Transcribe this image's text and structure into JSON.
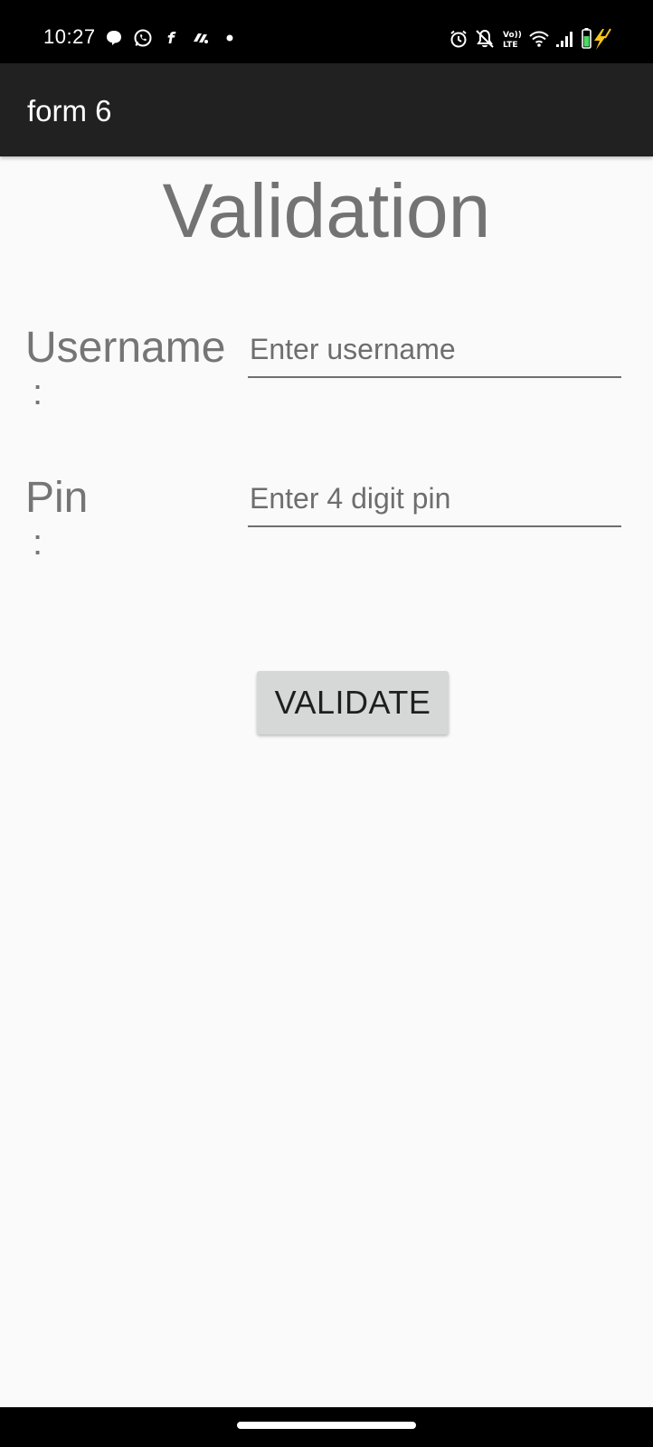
{
  "status_bar": {
    "time": "10:27",
    "left_icons": [
      "chat-bubble-icon",
      "whatsapp-icon",
      "flipkart-icon",
      "app-notification-icon",
      "more-dot-icon"
    ],
    "right_icons": [
      "alarm-icon",
      "notifications-muted-icon",
      "volte-icon",
      "wifi-icon",
      "cellular-signal-icon",
      "battery-charging-icon"
    ],
    "volte_text": "Vo)) LTE"
  },
  "app_bar": {
    "title": "form 6"
  },
  "main": {
    "heading": "Validation",
    "username": {
      "label": "Username",
      "colon": ":",
      "placeholder": "Enter username",
      "value": ""
    },
    "pin": {
      "label": "Pin",
      "colon": ":",
      "placeholder": "Enter 4 digit pin",
      "value": ""
    },
    "validate_button": "VALIDATE"
  },
  "colors": {
    "status_bar_bg": "#000000",
    "app_bar_bg": "#212121",
    "background": "#fafafa",
    "text_gray": "#757575",
    "button_bg": "#d6d7d7",
    "battery_green": "#4cd964",
    "charging_yellow": "#f5c518"
  }
}
